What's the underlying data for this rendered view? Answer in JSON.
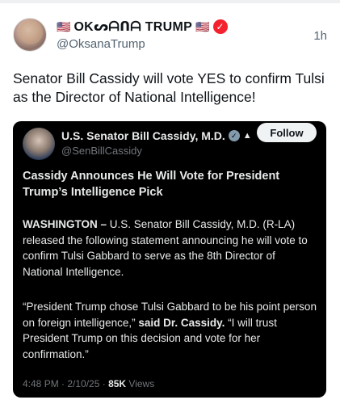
{
  "post": {
    "display_name": "OKᔕᗩᑎᗩ TRUMP",
    "flag_left": "🇺🇸",
    "flag_right": "🇺🇸",
    "verified_icon": "verified-check-icon",
    "handle": "@OksanaTrump",
    "time": "1h",
    "text": "Senator Bill Cassidy will vote YES to confirm Tulsi as the Director of National Intelligence!"
  },
  "quote": {
    "name": "U.S. Senator Bill Cassidy, M.D.",
    "handle": "@SenBillCassidy",
    "follow_label": "Follow",
    "headline": "Cassidy Announces He Will Vote for President Trump’s Intelligence Pick",
    "para1_dateline": "WASHINGTON –",
    "para1_rest": " U.S. Senator Bill Cassidy, M.D. (R-LA) released the following statement announcing he will vote to confirm Tulsi Gabbard to serve as the 8th Director of National Intelligence.",
    "para2_quote_a": "“President Trump chose Tulsi Gabbard to be his point person on foreign intelligence,” ",
    "para2_said": "said Dr. Cassidy.",
    "para2_quote_b": " “I will trust President Trump on this decision and vote for her confirmation.”",
    "timestamp": "4:48 PM · 2/10/25 · ",
    "views_count": "85K",
    "views_label": " Views"
  },
  "colors": {
    "verified_badge": "#f4212e",
    "gov_badge": "#829aab",
    "quote_background": "#000000",
    "secondary_text": "#536471"
  }
}
